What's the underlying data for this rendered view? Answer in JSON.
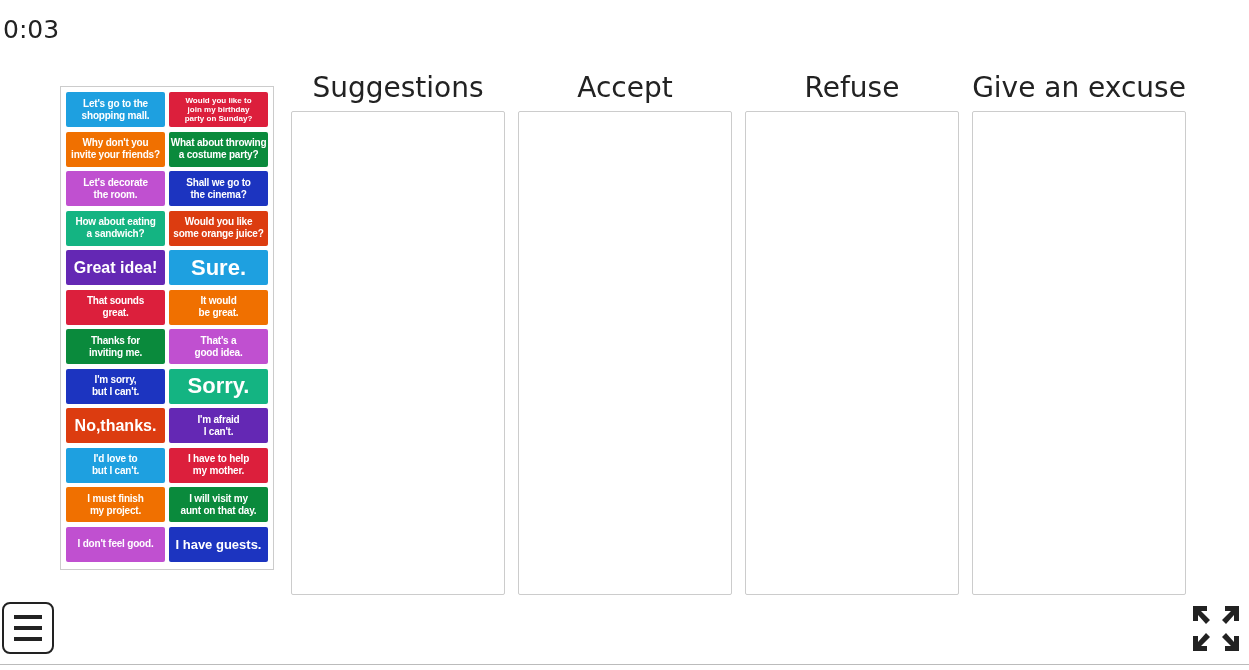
{
  "timer": "0:03",
  "cards": [
    {
      "text": "Let's go to the\nshopping mall.",
      "color": "#1ea0e0",
      "kind": "normal"
    },
    {
      "text": "Would you like to\njoin my birthday\nparty on Sunday?",
      "color": "#dc1f3c",
      "kind": "small"
    },
    {
      "text": "Why don't you\ninvite your friends?",
      "color": "#f07000",
      "kind": "normal"
    },
    {
      "text": "What about throwing\na costume party?",
      "color": "#0a8a3c",
      "kind": "normal"
    },
    {
      "text": "Let's decorate\nthe room.",
      "color": "#c050d0",
      "kind": "normal"
    },
    {
      "text": "Shall we go to\nthe cinema?",
      "color": "#1c34c0",
      "kind": "normal"
    },
    {
      "text": "How about eating\na sandwich?",
      "color": "#14b482",
      "kind": "normal"
    },
    {
      "text": "Would you like\nsome orange juice?",
      "color": "#dc3c10",
      "kind": "normal"
    },
    {
      "text": "Great idea!",
      "color": "#6428b4",
      "kind": "large"
    },
    {
      "text": "Sure.",
      "color": "#1ea0e0",
      "kind": "huge"
    },
    {
      "text": "That sounds\ngreat.",
      "color": "#dc1f3c",
      "kind": "normal"
    },
    {
      "text": "It would\nbe great.",
      "color": "#f07000",
      "kind": "normal"
    },
    {
      "text": "Thanks for\ninviting me.",
      "color": "#0a8a3c",
      "kind": "normal"
    },
    {
      "text": "That's a\ngood idea.",
      "color": "#c050d0",
      "kind": "normal"
    },
    {
      "text": "I'm sorry,\nbut I can't.",
      "color": "#1c34c0",
      "kind": "normal"
    },
    {
      "text": "Sorry.",
      "color": "#14b482",
      "kind": "huge"
    },
    {
      "text": "No,thanks.",
      "color": "#dc3c10",
      "kind": "large"
    },
    {
      "text": "I'm afraid\nI can't.",
      "color": "#6428b4",
      "kind": "normal"
    },
    {
      "text": "I'd love to\nbut I can't.",
      "color": "#1ea0e0",
      "kind": "normal"
    },
    {
      "text": "I have to help\nmy mother.",
      "color": "#dc1f3c",
      "kind": "normal"
    },
    {
      "text": "I must finish\nmy project.",
      "color": "#f07000",
      "kind": "normal"
    },
    {
      "text": "I will visit my\naunt on that day.",
      "color": "#0a8a3c",
      "kind": "normal"
    },
    {
      "text": "I don't feel good.",
      "color": "#c050d0",
      "kind": "normal"
    },
    {
      "text": "I have guests.",
      "color": "#1c34c0",
      "kind": "medium"
    }
  ],
  "columns": [
    {
      "title": "Suggestions"
    },
    {
      "title": "Accept"
    },
    {
      "title": "Refuse"
    },
    {
      "title": "Give an excuse"
    }
  ]
}
